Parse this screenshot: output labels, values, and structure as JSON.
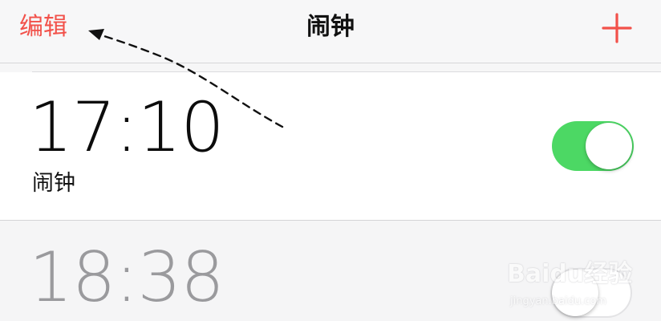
{
  "navbar": {
    "edit_label": "编辑",
    "title": "闹钟",
    "add_icon": "plus-icon"
  },
  "alarms": [
    {
      "time": "17:10",
      "label": "闹钟",
      "enabled": true
    },
    {
      "time": "18:38",
      "label": "",
      "enabled": false
    }
  ],
  "colors": {
    "accent": "#f2514a",
    "toggle_on": "#4cd864",
    "time_disabled": "#9a9a9d"
  },
  "watermark": {
    "brand": "Baidu经验",
    "url": "jingyan.baidu.com"
  }
}
